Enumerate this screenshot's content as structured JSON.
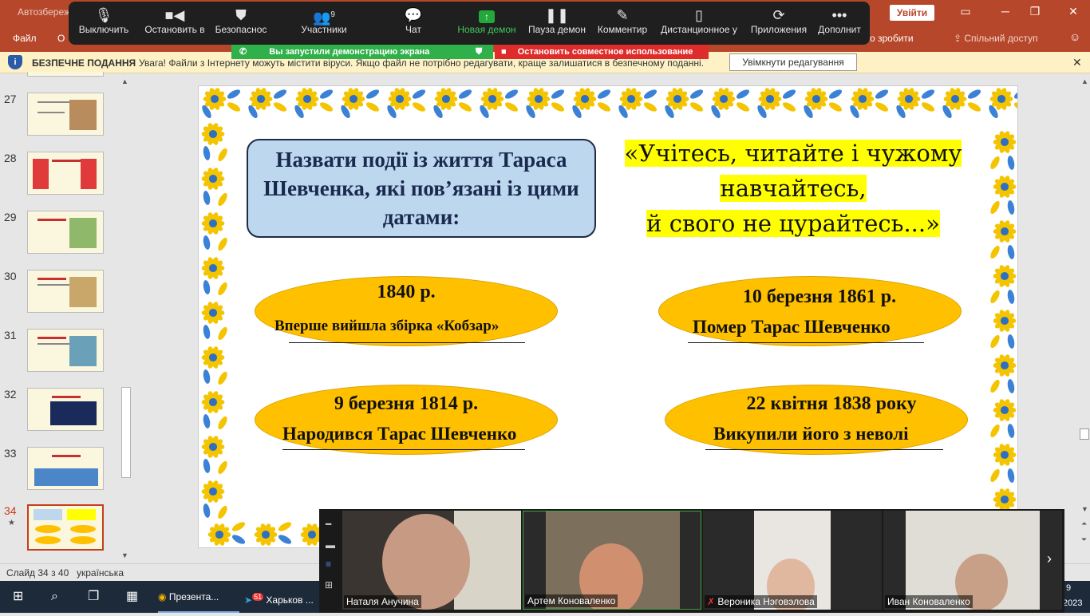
{
  "titlebar": {
    "autosave": "Автозбереж",
    "signin": "Увійти"
  },
  "ribbon": {
    "tabs": [
      "Файл",
      "О",
      "о зробити"
    ],
    "share": "Спільний доступ"
  },
  "zoom": {
    "buttons": [
      {
        "label": "Выключить",
        "icon": "microphone-icon"
      },
      {
        "label": "Остановить в",
        "icon": "video-camera-icon"
      },
      {
        "label": "Безопаснос",
        "icon": "shield-icon"
      },
      {
        "label": "Участники",
        "icon": "participants-icon",
        "count": "9"
      },
      {
        "label": "Чат",
        "icon": "chat-icon"
      },
      {
        "label": "Новая демон",
        "icon": "share-screen-icon"
      },
      {
        "label": "Пауза демон",
        "icon": "pause-icon"
      },
      {
        "label": "Комментир",
        "icon": "pencil-icon"
      },
      {
        "label": "Дистанционное у",
        "icon": "mouse-icon"
      },
      {
        "label": "Приложения",
        "icon": "apps-icon"
      },
      {
        "label": "Дополнит",
        "icon": "more-icon"
      }
    ],
    "banner_green": "Вы запустили демонстрацию экрана",
    "banner_red": "Остановить совместное использование"
  },
  "security": {
    "title": "БЕЗПЕЧНЕ ПОДАННЯ",
    "message": "Увага! Файли з Інтернету можуть містити віруси. Якщо файл не потрібно редагувати, краще залишатися в безпечному поданні.",
    "enable_button": "Увімкнути редагування"
  },
  "thumbnails": [
    {
      "num": "27",
      "selected": false
    },
    {
      "num": "28",
      "selected": false
    },
    {
      "num": "29",
      "selected": false
    },
    {
      "num": "30",
      "selected": false
    },
    {
      "num": "31",
      "selected": false
    },
    {
      "num": "32",
      "selected": false
    },
    {
      "num": "33",
      "selected": false
    },
    {
      "num": "34",
      "selected": true,
      "star": "★"
    }
  ],
  "slide": {
    "question": "Назвати події із життя Тараса Шевченка, які пов’язані із цими датами:",
    "quote_lines": [
      "«Учітесь, читайте і чужому",
      "навчайтесь,",
      "й свого не цурайтесь...»"
    ],
    "events": [
      {
        "date": "1840 р.",
        "event": "Вперше вийшла збірка «Кобзар»"
      },
      {
        "date": "10 березня 1861 р.",
        "event": "Помер Тарас Шевченко"
      },
      {
        "date": "9 березня 1814 р.",
        "event": "Народився Тарас Шевченко"
      },
      {
        "date": "22 квітня 1838 року",
        "event": "Викупили його з неволі"
      }
    ]
  },
  "video": {
    "participants": [
      "Наталя Анучина",
      "Артем Коноваленко",
      "Вероника Нэговэлова",
      "Иван Коноваленко"
    ]
  },
  "status": {
    "slide": "Слайд 34 з 40",
    "language": "українська"
  },
  "taskbar": {
    "apps": [
      "Презента...",
      "Харьков ..."
    ],
    "telegram_badge": "51",
    "clock_time": "9",
    "clock_year": "2023"
  },
  "colors": {
    "accent": "#b7472a",
    "slide_yellow": "#ffc000",
    "question_box": "#bdd7ee",
    "quote_highlight": "#ffff00"
  }
}
